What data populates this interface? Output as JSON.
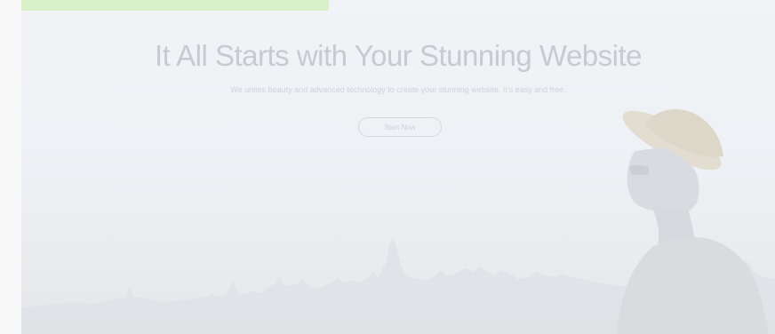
{
  "hero": {
    "title": "It All Starts with Your Stunning Website",
    "subtitle": "We unites beauty and advanced technology to create your stunning website. It’s easy and free.",
    "cta_label": "Start Now"
  },
  "colors": {
    "banner": "#d9efc8",
    "title": "#c5cbd2",
    "background": "#eef1f5"
  },
  "icons": {
    "skyline": "city-skyline-image",
    "person": "person-with-hat-image"
  }
}
